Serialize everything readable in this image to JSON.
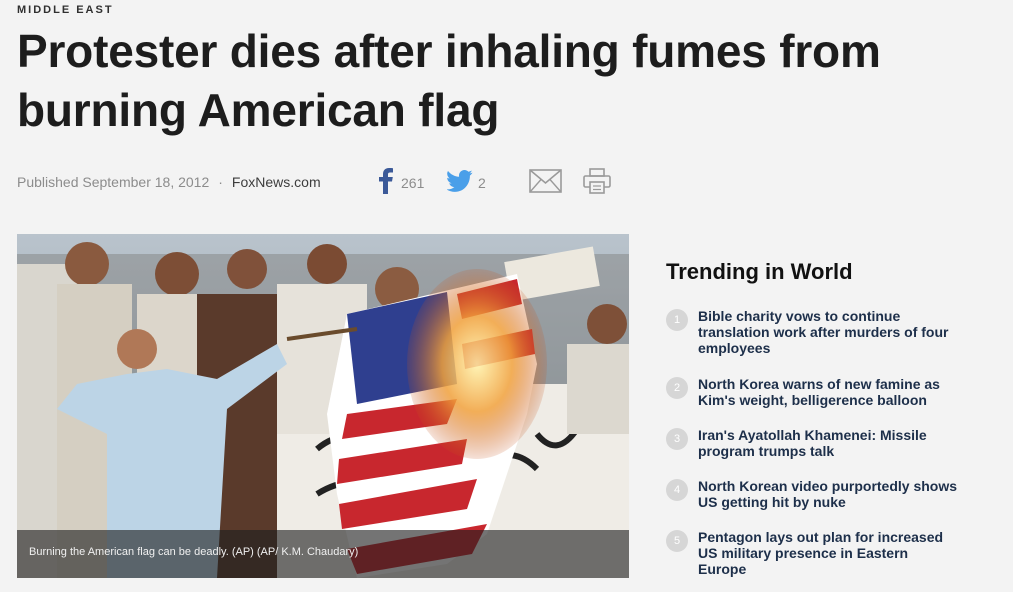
{
  "section": "MIDDLE EAST",
  "headline": "Protester dies after inhaling fumes from burning American flag",
  "meta": {
    "published": "Published September 18, 2012",
    "separator": "·",
    "source": "FoxNews.com"
  },
  "share": {
    "facebook_count": "261",
    "twitter_count": "2",
    "colors": {
      "facebook": "#3b5998",
      "twitter": "#4a9fe9",
      "icon_gray": "#9a9a9a"
    }
  },
  "photo": {
    "caption": "Burning the American flag can be deadly. (AP) (AP/ K.M. Chaudary)"
  },
  "trending": {
    "title": "Trending in World",
    "items": [
      {
        "number": "1",
        "title": "Bible charity vows to continue translation work after murders of four employees"
      },
      {
        "number": "2",
        "title": "North Korea warns of new famine as Kim's weight, belligerence balloon"
      },
      {
        "number": "3",
        "title": "Iran's Ayatollah Khamenei: Missile program trumps talk"
      },
      {
        "number": "4",
        "title": "North Korean video purportedly shows US getting hit by nuke"
      },
      {
        "number": "5",
        "title": "Pentagon lays out plan for increased US military presence in Eastern Europe"
      }
    ]
  },
  "icons": {
    "facebook": "facebook-icon",
    "twitter": "twitter-icon",
    "email": "email-icon",
    "print": "print-icon"
  }
}
